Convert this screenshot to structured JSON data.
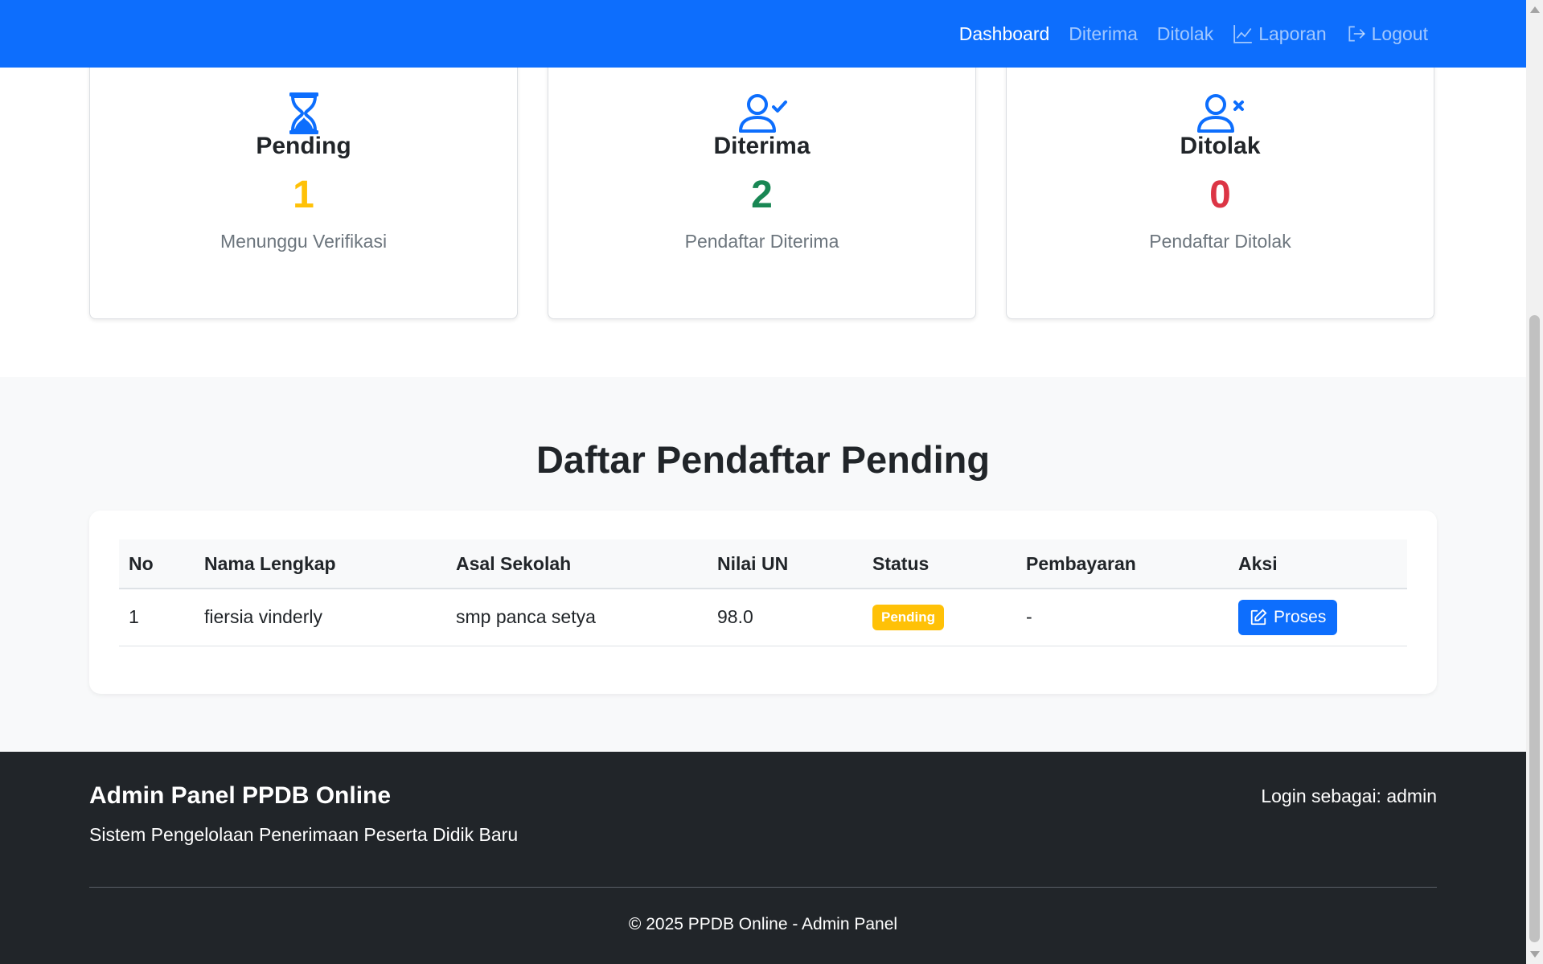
{
  "nav": {
    "items": [
      {
        "label": "Dashboard",
        "icon": null,
        "active": true
      },
      {
        "label": "Diterima",
        "icon": null,
        "active": false
      },
      {
        "label": "Ditolak",
        "icon": null,
        "active": false
      },
      {
        "label": "Laporan",
        "icon": "chart-line-icon",
        "active": false
      },
      {
        "label": "Logout",
        "icon": "logout-icon",
        "active": false
      }
    ]
  },
  "stats": [
    {
      "icon": "hourglass-icon",
      "title": "Pending",
      "value": "1",
      "desc": "Menunggu Verifikasi",
      "color": "#ffc107"
    },
    {
      "icon": "user-check-icon",
      "title": "Diterima",
      "value": "2",
      "desc": "Pendaftar Diterima",
      "color": "#198754"
    },
    {
      "icon": "user-x-icon",
      "title": "Ditolak",
      "value": "0",
      "desc": "Pendaftar Ditolak",
      "color": "#dc3545"
    }
  ],
  "pending": {
    "heading": "Daftar Pendaftar Pending",
    "columns": [
      "No",
      "Nama Lengkap",
      "Asal Sekolah",
      "Nilai UN",
      "Status",
      "Pembayaran",
      "Aksi"
    ],
    "rows": [
      {
        "no": "1",
        "nama": "fiersia vinderly",
        "sekolah": "smp panca setya",
        "nilai": "98.0",
        "status": "Pending",
        "pembayaran": "-",
        "aksi": "Proses"
      }
    ]
  },
  "footer": {
    "brand": "Admin Panel PPDB Online",
    "tagline": "Sistem Pengelolaan Penerimaan Peserta Didik Baru",
    "login": "Login sebagai: admin",
    "copyright": "© 2025 PPDB Online - Admin Panel"
  },
  "colors": {
    "primary": "#0d6efd",
    "warning": "#ffc107",
    "success": "#198754",
    "danger": "#dc3545",
    "footer_bg": "#212529"
  }
}
